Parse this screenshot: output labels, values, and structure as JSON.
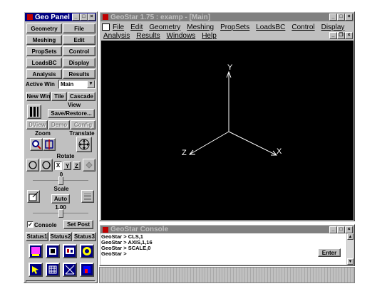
{
  "geo_panel": {
    "title": "Geo Panel",
    "buttons_grid": [
      "Geometry",
      "File",
      "Meshing",
      "Edit",
      "PropSets",
      "Control",
      "LoadsBC",
      "Display",
      "Analysis",
      "Results"
    ],
    "active_win_label": "Active Win",
    "active_win_value": "Main",
    "win_buttons": [
      "New Win",
      "Tile",
      "Cascade"
    ],
    "view_label": "View",
    "save_restore": "Save/Restore...",
    "view_buttons": [
      "DView",
      "Demo",
      "Config"
    ],
    "zoom_label": "Zoom",
    "translate_label": "Translate",
    "rotate_label": "Rotate",
    "axis_buttons": [
      "X",
      "Y",
      "Z"
    ],
    "rotate_value": "0",
    "scale_label": "Scale",
    "auto_label": "Auto",
    "scale_value": "1.00",
    "console_checkbox": "Console",
    "set_post": "Set Post",
    "status_buttons": [
      "Status1",
      "Status2",
      "Status3"
    ]
  },
  "main_window": {
    "title": "GeoStar 1.75 : examp - [Main]",
    "menu_row1": [
      "File",
      "Edit",
      "Geometry",
      "Meshing",
      "PropSets",
      "LoadsBC",
      "Control",
      "Display"
    ],
    "menu_row2": [
      "Analysis",
      "Results",
      "Windows",
      "Help"
    ],
    "axes": {
      "y": "Y",
      "x": "X",
      "z": "Z"
    }
  },
  "console": {
    "title": "GeoStar Console",
    "lines": [
      "GeoStar > CLS,1",
      "GeoStar > AXIS,1,16",
      "GeoStar > SCALE,0",
      "GeoStar >"
    ],
    "enter_label": "Enter"
  },
  "colors": {
    "titlebar_active": "#000080",
    "titlebar_inactive": "#808080",
    "panel": "#c0c0c0",
    "viewport": "#000000"
  }
}
